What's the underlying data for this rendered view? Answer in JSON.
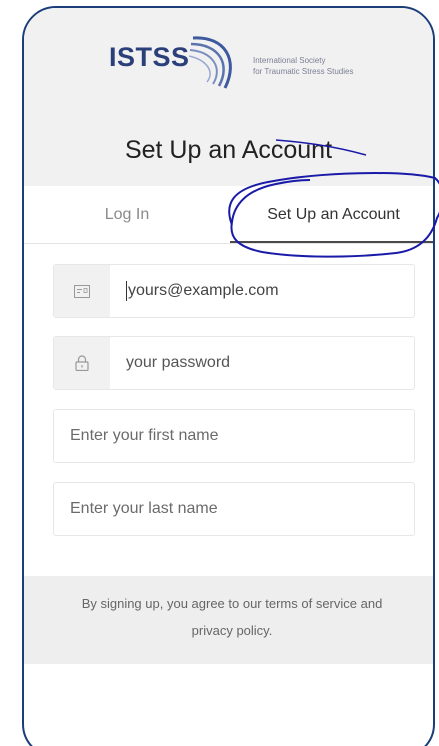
{
  "logo": {
    "acronym": "ISTSS",
    "org_line1": "International Society",
    "org_line2": "for Traumatic Stress Studies"
  },
  "page_title": "Set Up an Account",
  "tabs": [
    {
      "label": "Log In",
      "active": false
    },
    {
      "label": "Set Up an Account",
      "active": true
    }
  ],
  "form": {
    "email": {
      "value": "yours@example.com",
      "icon": "email-card-icon"
    },
    "password": {
      "placeholder": "your password",
      "icon": "lock-icon"
    },
    "first_name": {
      "placeholder": "Enter your first name"
    },
    "last_name": {
      "placeholder": "Enter your last name"
    }
  },
  "terms": {
    "text_line1": "By signing up, you agree to our terms of service and",
    "text_line2": "privacy policy."
  },
  "colors": {
    "frame_border": "#1b3e78",
    "annotation_ink": "#1a1aa8",
    "logo_blue": "#2b3f7a"
  }
}
